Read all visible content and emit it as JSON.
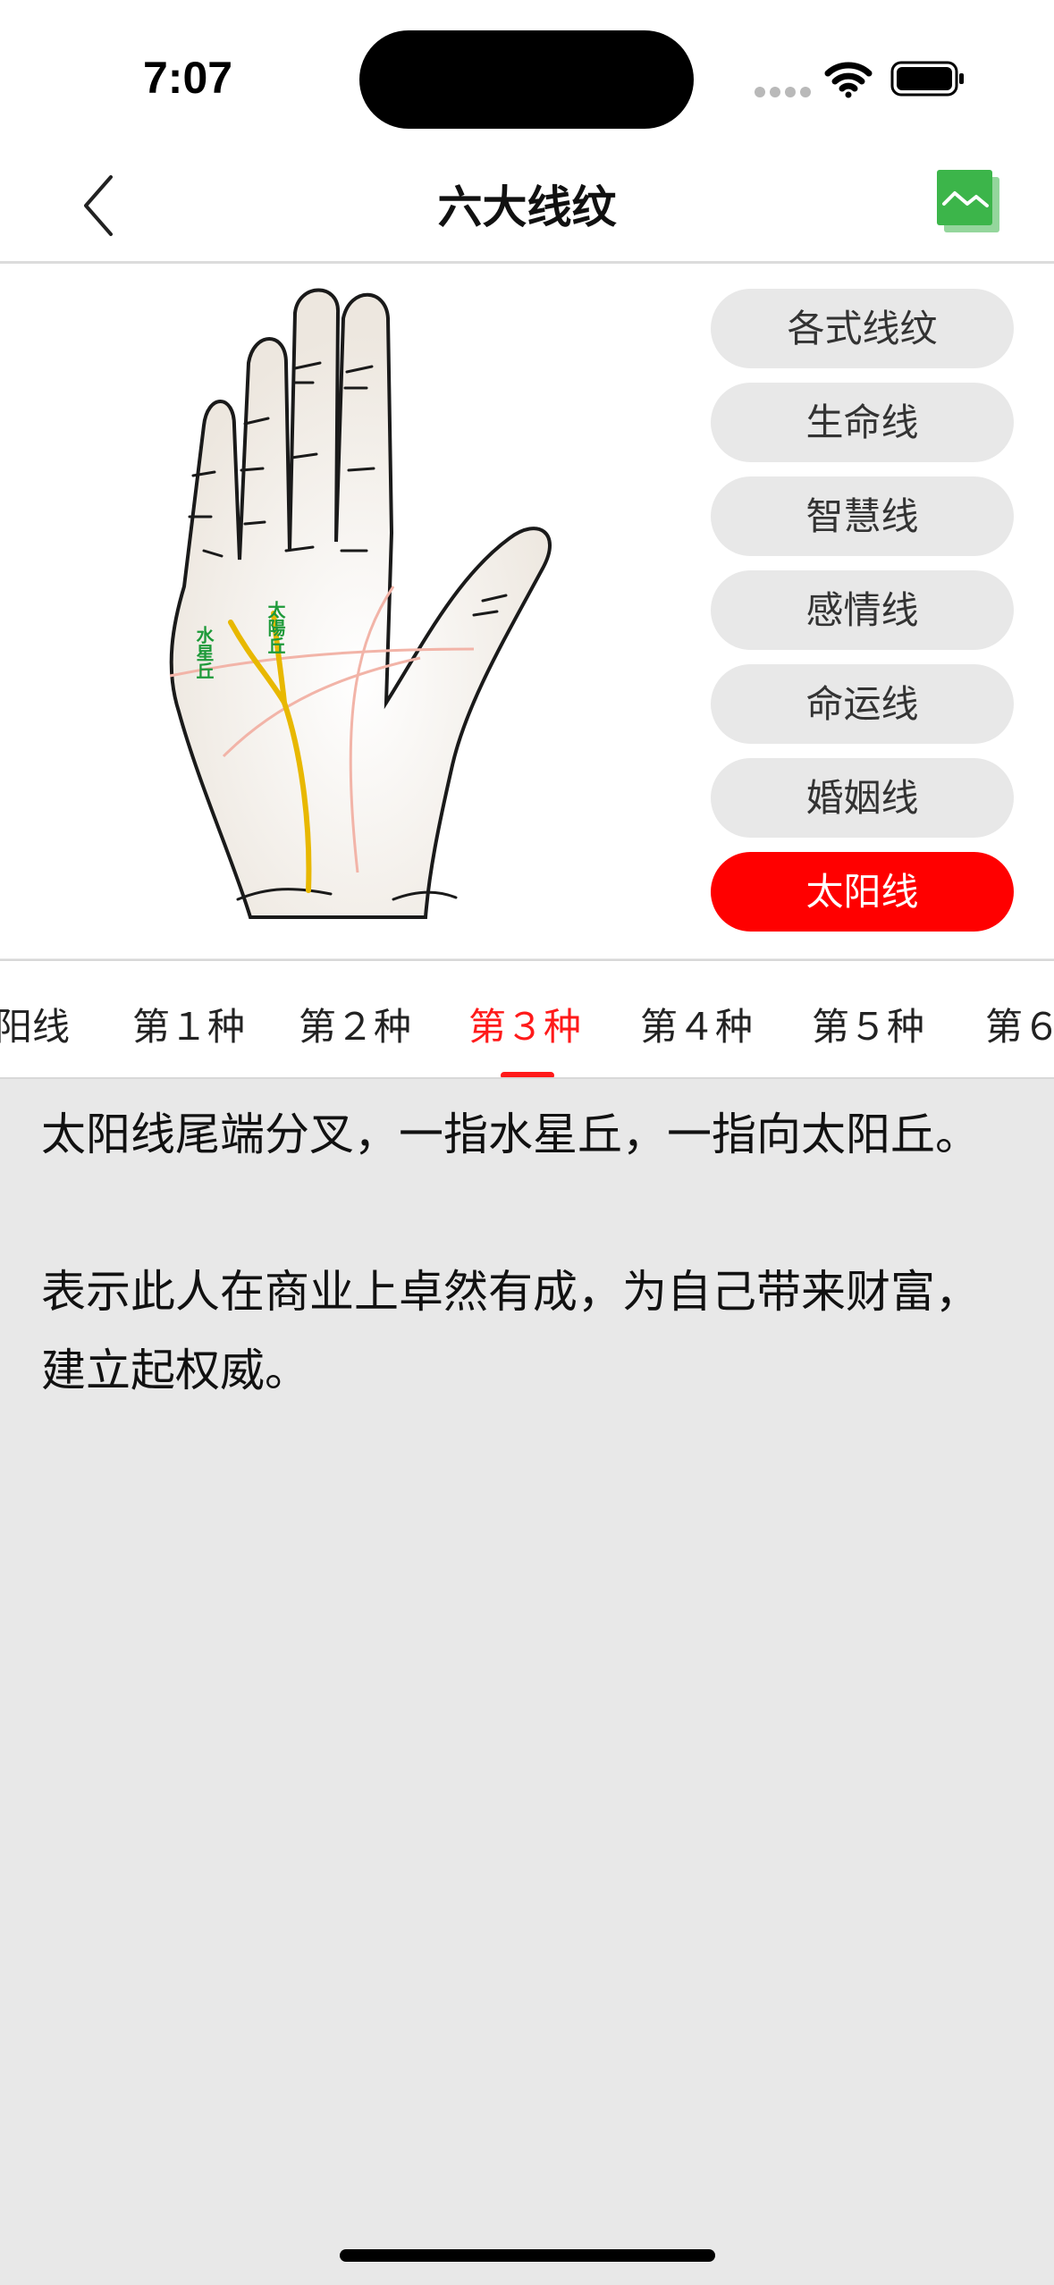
{
  "status_bar": {
    "time": "7:07"
  },
  "nav": {
    "title": "六大线纹",
    "back_icon": "chevron-left-icon",
    "gallery_icon": "gallery-icon"
  },
  "palm_image": {
    "labels": {
      "mercury_mount": "水星丘",
      "sun_mount": "太陽丘"
    }
  },
  "line_types": [
    {
      "label": "各式线纹"
    },
    {
      "label": "生命线"
    },
    {
      "label": "智慧线"
    },
    {
      "label": "感情线"
    },
    {
      "label": "命运线"
    },
    {
      "label": "婚姻线"
    },
    {
      "label": "太阳线",
      "active": true
    }
  ],
  "tabs": [
    {
      "label": "阳线"
    },
    {
      "label": "第１种"
    },
    {
      "label": "第２种"
    },
    {
      "label": "第３种",
      "active": true
    },
    {
      "label": "第４种"
    },
    {
      "label": "第５种"
    },
    {
      "label": "第６"
    }
  ],
  "description": {
    "paragraph_1": "太阳线尾端分叉，一指水星丘，一指向太阳丘。",
    "paragraph_2": "表示此人在商业上卓然有成，为自己带来财富，建立起权威。"
  },
  "colors": {
    "accent": "#ff0000",
    "gallery_green": "#3cb54a",
    "line_yellow": "#e8b800",
    "label_green": "#1e9a3a"
  }
}
